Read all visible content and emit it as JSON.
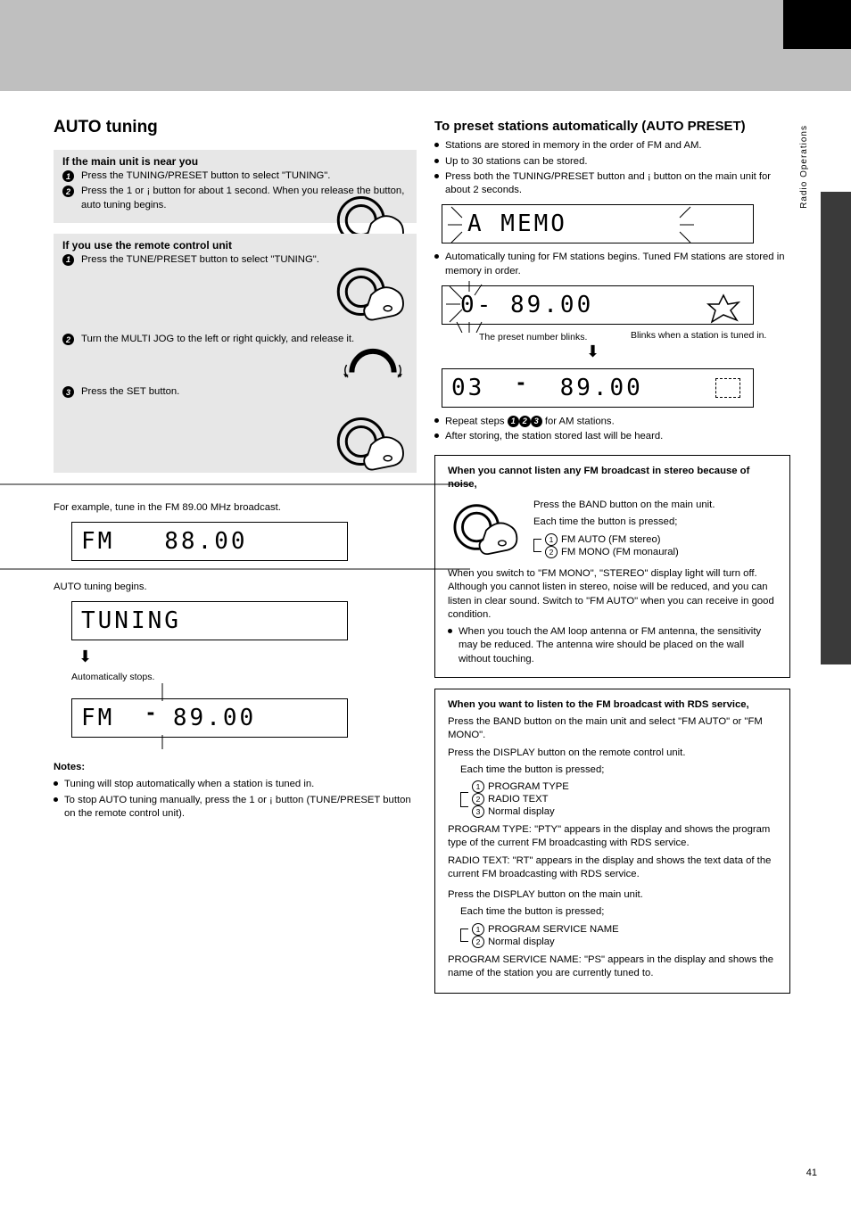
{
  "tab_side": "Radio Operations",
  "page_number": "41",
  "left": {
    "title": "AUTO tuning",
    "ifclose_title": "If the main unit is near you",
    "ifclose_step1": "Press the TUNING/PRESET button to select \"TUNING\".",
    "ifclose_step2": "Press the 1 or ¡ button for about 1 second. When you release the button, auto tuning begins.",
    "ifremote_title": "If you use the remote control unit",
    "ifremote_step1": "Press the TUNE/PRESET button to select \"TUNING\".",
    "ifremote_step2": "Turn the MULTI JOG to the left or right quickly, and release it.",
    "ifremote_step3": "Press the SET button.",
    "eg1_heading": "For example, tune in the FM 89.00 MHz broadcast.",
    "eg1_lcd_fm8800_a": "FM",
    "eg1_lcd_fm8800_b": "88.00",
    "begins_lbl": "AUTO tuning begins.",
    "eg1_lcd_tuning": "TUNING",
    "autostop_lbl": "Automatically stops.",
    "eg1_lcd_fm8900_a": "FM",
    "eg1_lcd_fm8900_b": "89.00",
    "notes_heading": "Notes:",
    "note1": "Tuning will stop automatically when a station is tuned in.",
    "note2": "To stop AUTO tuning manually, press the 1 or ¡ button (TUNE/PRESET button on the remote control unit)."
  },
  "right": {
    "autopreset_title": "To preset stations automatically (AUTO PRESET)",
    "intro1": "Stations are stored in memory in the order of FM and AM.",
    "intro2": "Up to 30 stations can be stored.",
    "intro3": "Press both the TUNING/PRESET button and ¡ button on the main unit for about 2 seconds.",
    "lcd_amemo": "A MEMO",
    "intro4": "Automatically tuning for FM stations begins. Tuned FM stations are stored in memory in order.",
    "lcd_0_8900": "0- 89.00",
    "lcd_03_8900_a": "03",
    "lcd_03_8900_b": "89.00",
    "preset_arrow_lbl": "The preset number blinks.",
    "tuned_arrow_lbl": "Blinks when a station is tuned in.",
    "repeat_steps": "Repeat steps ",
    "repeat_steps_tail": " for AM stations.",
    "last_after": "After storing, the station stored last will be heard.",
    "mono_title": "When you cannot listen any FM broadcast in stereo because of noise,",
    "mono_lead": "Press the BAND button on the main unit.",
    "mono_each": "Each time the button is pressed;",
    "mono_fm": " FM AUTO (FM stereo)",
    "mono_fmmono": " FM MONO (FM monaural)",
    "mono_para": "When you switch to \"FM MONO\", \"STEREO\" display light will turn off. Although you cannot listen in stereo, noise will be reduced, and you can listen in clear sound. Switch to \"FM AUTO\" when you can receive in good condition.",
    "mono_note": "When you touch the AM loop antenna or FM antenna, the sensitivity may be reduced. The antenna wire should be placed on the wall without touching.",
    "rds_title": "When you want to listen to the FM broadcast with RDS service,",
    "rds_lead1": "Press the BAND button on the main unit and select \"FM AUTO\" or \"FM MONO\".",
    "rds_lead2": "Press the DISPLAY button on the remote control unit.",
    "rds_each2": "Each time the button is pressed;",
    "rds_pty": " PROGRAM TYPE",
    "rds_rt": " RADIO TEXT",
    "rds_normal": " Normal display",
    "rds_ptyblock": "PROGRAM TYPE: \"PTY\" appears in the display and shows the program type of the current FM broadcasting with RDS service.",
    "rds_rtblock": "RADIO TEXT: \"RT\" appears in the display and shows the text data of the current FM broadcasting with RDS service.",
    "rds_pslead": "Press the DISPLAY button on the main unit.",
    "rds_each3": "Each time the button is pressed;",
    "rds_ps": " PROGRAM SERVICE NAME",
    "rds_ps_normal": " Normal display",
    "rds_psblock": "PROGRAM SERVICE NAME: \"PS\" appears in the display and shows the name of the station you are currently tuned to."
  }
}
